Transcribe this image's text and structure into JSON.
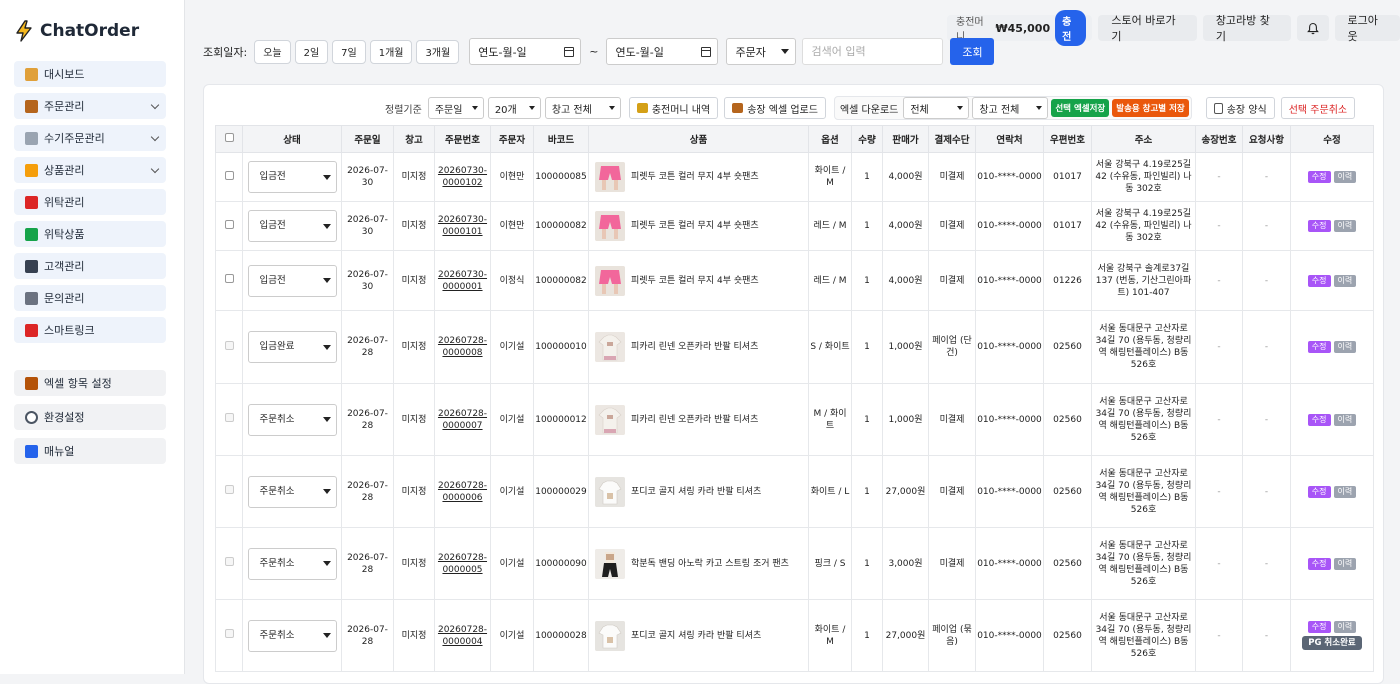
{
  "app": {
    "name": "ChatOrder"
  },
  "sidebar": {
    "items": [
      {
        "label": "대시보드",
        "icon": "bar-chart-icon",
        "color": "#e0a03a",
        "chevron": false
      },
      {
        "label": "주문관리",
        "icon": "box-icon",
        "color": "#b5651d",
        "chevron": true
      },
      {
        "label": "수기주문관리",
        "icon": "memo-icon",
        "color": "#9aa4b1",
        "chevron": true
      },
      {
        "label": "상품관리",
        "icon": "tag-icon",
        "color": "#f59e0b",
        "chevron": true
      },
      {
        "label": "위탁관리",
        "icon": "truck-icon",
        "color": "#dc2626",
        "chevron": false
      },
      {
        "label": "위탁상품",
        "icon": "puzzle-icon",
        "color": "#16a34a",
        "chevron": false
      },
      {
        "label": "고객관리",
        "icon": "users-icon",
        "color": "#374151",
        "chevron": false
      },
      {
        "label": "문의관리",
        "icon": "chat-icon",
        "color": "#6b7280",
        "chevron": false
      },
      {
        "label": "스마트링크",
        "icon": "link-chart-icon",
        "color": "#dc2626",
        "chevron": false
      }
    ],
    "settings": [
      {
        "label": "엑셀 항목 설정",
        "icon": "clipboard-icon",
        "color": "#b45309"
      },
      {
        "label": "환경설정",
        "icon": "gear-icon",
        "color": "#4b5563"
      },
      {
        "label": "매뉴얼",
        "icon": "book-icon",
        "color": "#2563eb"
      }
    ]
  },
  "topbar": {
    "charge_label": "충전머니",
    "charge_amount": "₩45,000",
    "charge_button": "충전",
    "store_button": "스토어 바로가기",
    "warehouse_button": "창고라방 찾기",
    "logout_button": "로그아웃"
  },
  "filter": {
    "label": "조회일자:",
    "quick": [
      "오늘",
      "2일",
      "7일",
      "1개월",
      "3개월"
    ],
    "date_from": "연도-월-일",
    "date_to": "연도-월-일",
    "tilde": "~",
    "field_select": "주문자",
    "search_placeholder": "검색어 입력",
    "search_button": "조회"
  },
  "toolbar": {
    "sort_label": "정렬기준",
    "sort_value": "주문일",
    "count_value": "20개",
    "warehouse_value": "창고 전체",
    "charge_history": "충전머니 내역",
    "invoice_upload": "송장 엑셀 업로드",
    "excel_download_label": "엑셀 다운로드",
    "excel_scope": "전체",
    "excel_warehouse": "창고 전체",
    "save_selected": "선택 엑셀저장",
    "save_by_warehouse": "발송용 창고별 저장",
    "invoice_form": "송장 양식",
    "cancel_selected": "선택 주문취소",
    "colors": {
      "green": "#16a34a",
      "orange": "#ea580c"
    }
  },
  "table": {
    "headers": [
      "",
      "상태",
      "주문일",
      "창고",
      "주문번호",
      "주문자",
      "바코드",
      "상품",
      "옵션",
      "수량",
      "판매가",
      "결제수단",
      "연락처",
      "우편번호",
      "주소",
      "송장번호",
      "요청사항",
      "수정"
    ],
    "edit_label": "수정",
    "history_label": "이력",
    "rows": [
      {
        "status": "입금전",
        "date": "2026-07-30",
        "wh": "미지정",
        "order_no": "20260730-0000102",
        "customer": "이현만",
        "barcode": "100000085",
        "product": "피렛두 코튼 컬러 무지 4부 숏팬츠",
        "thumb": "pink-shorts",
        "option": "화이트 / M",
        "qty": "1",
        "price": "4,000원",
        "pay": "미결제",
        "phone": "010-****-0000",
        "zip": "01017",
        "addr": "서울 강북구 4.19로25길 42 (수유동, 파인빌리) 나동 302호",
        "invoice": "-",
        "request": "-",
        "disabled": false,
        "pg": ""
      },
      {
        "status": "입금전",
        "date": "2026-07-30",
        "wh": "미지정",
        "order_no": "20260730-0000101",
        "customer": "이현만",
        "barcode": "100000082",
        "product": "피렛두 코튼 컬러 무지 4부 숏팬츠",
        "thumb": "pink-shorts",
        "option": "레드 / M",
        "qty": "1",
        "price": "4,000원",
        "pay": "미결제",
        "phone": "010-****-0000",
        "zip": "01017",
        "addr": "서울 강북구 4.19로25길 42 (수유동, 파인빌리) 나동 302호",
        "invoice": "-",
        "request": "-",
        "disabled": false,
        "pg": ""
      },
      {
        "status": "입금전",
        "date": "2026-07-30",
        "wh": "미지정",
        "order_no": "20260730-0000001",
        "customer": "이정식",
        "barcode": "100000082",
        "product": "피렛두 코튼 컬러 무지 4부 숏팬츠",
        "thumb": "pink-shorts",
        "option": "레드 / M",
        "qty": "1",
        "price": "4,000원",
        "pay": "미결제",
        "phone": "010-****-0000",
        "zip": "01226",
        "addr": "서울 강북구 솔계로37길 137 (번동, 기산그린아파트) 101-407",
        "invoice": "-",
        "request": "-",
        "disabled": false,
        "pg": ""
      },
      {
        "status": "입금완료",
        "date": "2026-07-28",
        "wh": "미지정",
        "order_no": "20260728-0000008",
        "customer": "이기설",
        "barcode": "100000010",
        "product": "피카리 린넨 오픈카라 반팔 티셔츠",
        "thumb": "beige-shirt",
        "option": "S / 화이트",
        "qty": "1",
        "price": "1,000원",
        "pay": "페이업 (단건)",
        "phone": "010-****-0000",
        "zip": "02560",
        "addr": "서울 동대문구 고산자로34길 70 (용두동, 청량리역 해링턴플레이스) B동 526호",
        "invoice": "-",
        "request": "-",
        "disabled": true,
        "pg": ""
      },
      {
        "status": "주문취소",
        "date": "2026-07-28",
        "wh": "미지정",
        "order_no": "20260728-0000007",
        "customer": "이기설",
        "barcode": "100000012",
        "product": "피카리 린넨 오픈카라 반팔 티셔츠",
        "thumb": "beige-shirt",
        "option": "M / 화이트",
        "qty": "1",
        "price": "1,000원",
        "pay": "미결제",
        "phone": "010-****-0000",
        "zip": "02560",
        "addr": "서울 동대문구 고산자로34길 70 (용두동, 청량리역 해링턴플레이스) B동 526호",
        "invoice": "-",
        "request": "-",
        "disabled": true,
        "pg": ""
      },
      {
        "status": "주문취소",
        "date": "2026-07-28",
        "wh": "미지정",
        "order_no": "20260728-0000006",
        "customer": "이기설",
        "barcode": "100000029",
        "product": "포디코 골지 셔링 카라 반팔 티셔츠",
        "thumb": "white-shirt",
        "option": "화이트 / L",
        "qty": "1",
        "price": "27,000원",
        "pay": "미결제",
        "phone": "010-****-0000",
        "zip": "02560",
        "addr": "서울 동대문구 고산자로34길 70 (용두동, 청량리역 해링턴플레이스) B동 526호",
        "invoice": "-",
        "request": "-",
        "disabled": true,
        "pg": ""
      },
      {
        "status": "주문취소",
        "date": "2026-07-28",
        "wh": "미지정",
        "order_no": "20260728-0000005",
        "customer": "이기설",
        "barcode": "100000090",
        "product": "학분독 밴딩 아노락 카고 스트링 조거 팬츠",
        "thumb": "black-pants",
        "option": "핑크 / S",
        "qty": "1",
        "price": "3,000원",
        "pay": "미결제",
        "phone": "010-****-0000",
        "zip": "02560",
        "addr": "서울 동대문구 고산자로34길 70 (용두동, 청량리역 해링턴플레이스) B동 526호",
        "invoice": "-",
        "request": "-",
        "disabled": true,
        "pg": ""
      },
      {
        "status": "주문취소",
        "date": "2026-07-28",
        "wh": "미지정",
        "order_no": "20260728-0000004",
        "customer": "이기설",
        "barcode": "100000028",
        "product": "포디코 골지 셔링 카라 반팔 티셔츠",
        "thumb": "white-shirt",
        "option": "화이트 / M",
        "qty": "1",
        "price": "27,000원",
        "pay": "페이업 (묶음)",
        "phone": "010-****-0000",
        "zip": "02560",
        "addr": "서울 동대문구 고산자로34길 70 (용두동, 청량리역 해링턴플레이스) B동 526호",
        "invoice": "-",
        "request": "-",
        "disabled": true,
        "pg": "PG 취소완료"
      }
    ]
  }
}
